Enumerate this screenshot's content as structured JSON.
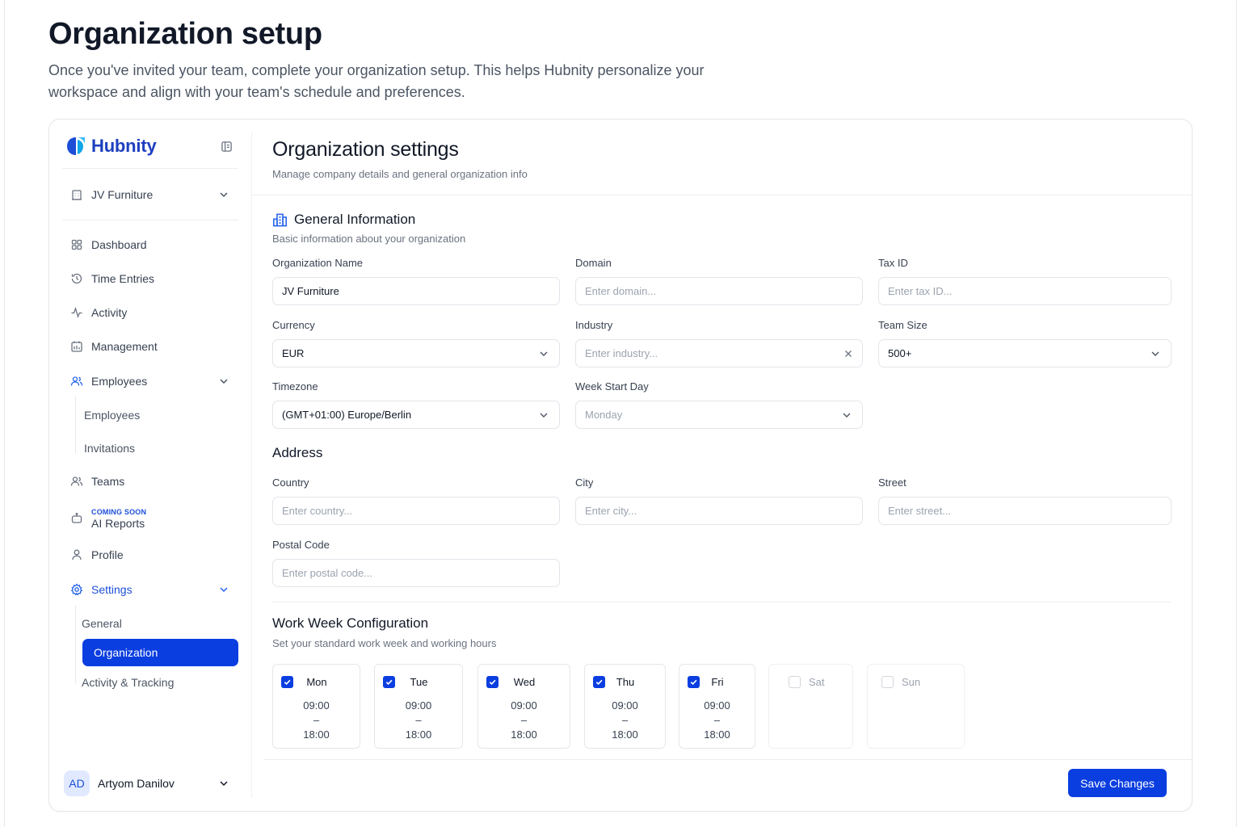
{
  "intro": {
    "title": "Organization setup",
    "description": "Once you've invited your team, complete your organization setup. This helps Hubnity personalize your workspace and align with your team's schedule and preferences."
  },
  "colors": {
    "brand": "#1d3fbf",
    "accent": "#0b3ee0",
    "muted": "#6b7280"
  },
  "sidebar": {
    "brand": "Hubnity",
    "org": "JV Furniture",
    "nav": {
      "dashboard": "Dashboard",
      "time_entries": "Time Entries",
      "activity": "Activity",
      "management": "Management",
      "employees": "Employees",
      "employees_sub": [
        "Employees",
        "Invitations"
      ],
      "teams": "Teams",
      "ai_badge": "COMING SOON",
      "ai_reports": "AI Reports",
      "profile": "Profile",
      "settings": "Settings",
      "settings_sub": [
        "General",
        "Organization",
        "Activity & Tracking"
      ]
    },
    "user": {
      "initials": "AD",
      "name": "Artyom Danilov"
    }
  },
  "main": {
    "title": "Organization settings",
    "subtitle": "Manage company details and general organization info",
    "general": {
      "title": "General Information",
      "subtitle": "Basic information about your organization",
      "org_name": {
        "label": "Organization Name",
        "value": "JV Furniture"
      },
      "domain": {
        "label": "Domain",
        "placeholder": "Enter domain..."
      },
      "tax_id": {
        "label": "Tax ID",
        "placeholder": "Enter tax ID..."
      },
      "currency": {
        "label": "Currency",
        "value": "EUR"
      },
      "industry": {
        "label": "Industry",
        "placeholder": "Enter industry..."
      },
      "team_size": {
        "label": "Team Size",
        "value": "500+"
      },
      "timezone": {
        "label": "Timezone",
        "value": "(GMT+01:00) Europe/Berlin"
      },
      "week_start": {
        "label": "Week Start Day",
        "value": "Monday"
      }
    },
    "address": {
      "title": "Address",
      "country": {
        "label": "Country",
        "placeholder": "Enter country..."
      },
      "city": {
        "label": "City",
        "placeholder": "Enter city..."
      },
      "street": {
        "label": "Street",
        "placeholder": "Enter street..."
      },
      "postal": {
        "label": "Postal Code",
        "placeholder": "Enter postal code..."
      }
    },
    "work_week": {
      "title": "Work Week Configuration",
      "subtitle": "Set your standard work week and working hours",
      "days": [
        {
          "name": "Mon",
          "enabled": true,
          "start": "09:00",
          "sep": "–",
          "end": "18:00"
        },
        {
          "name": "Tue",
          "enabled": true,
          "start": "09:00",
          "sep": "–",
          "end": "18:00"
        },
        {
          "name": "Wed",
          "enabled": true,
          "start": "09:00",
          "sep": "–",
          "end": "18:00"
        },
        {
          "name": "Thu",
          "enabled": true,
          "start": "09:00",
          "sep": "–",
          "end": "18:00"
        },
        {
          "name": "Fri",
          "enabled": true,
          "start": "09:00",
          "sep": "–",
          "end": "18:00"
        },
        {
          "name": "Sat",
          "enabled": false
        },
        {
          "name": "Sun",
          "enabled": false
        }
      ]
    },
    "save_label": "Save Changes"
  }
}
